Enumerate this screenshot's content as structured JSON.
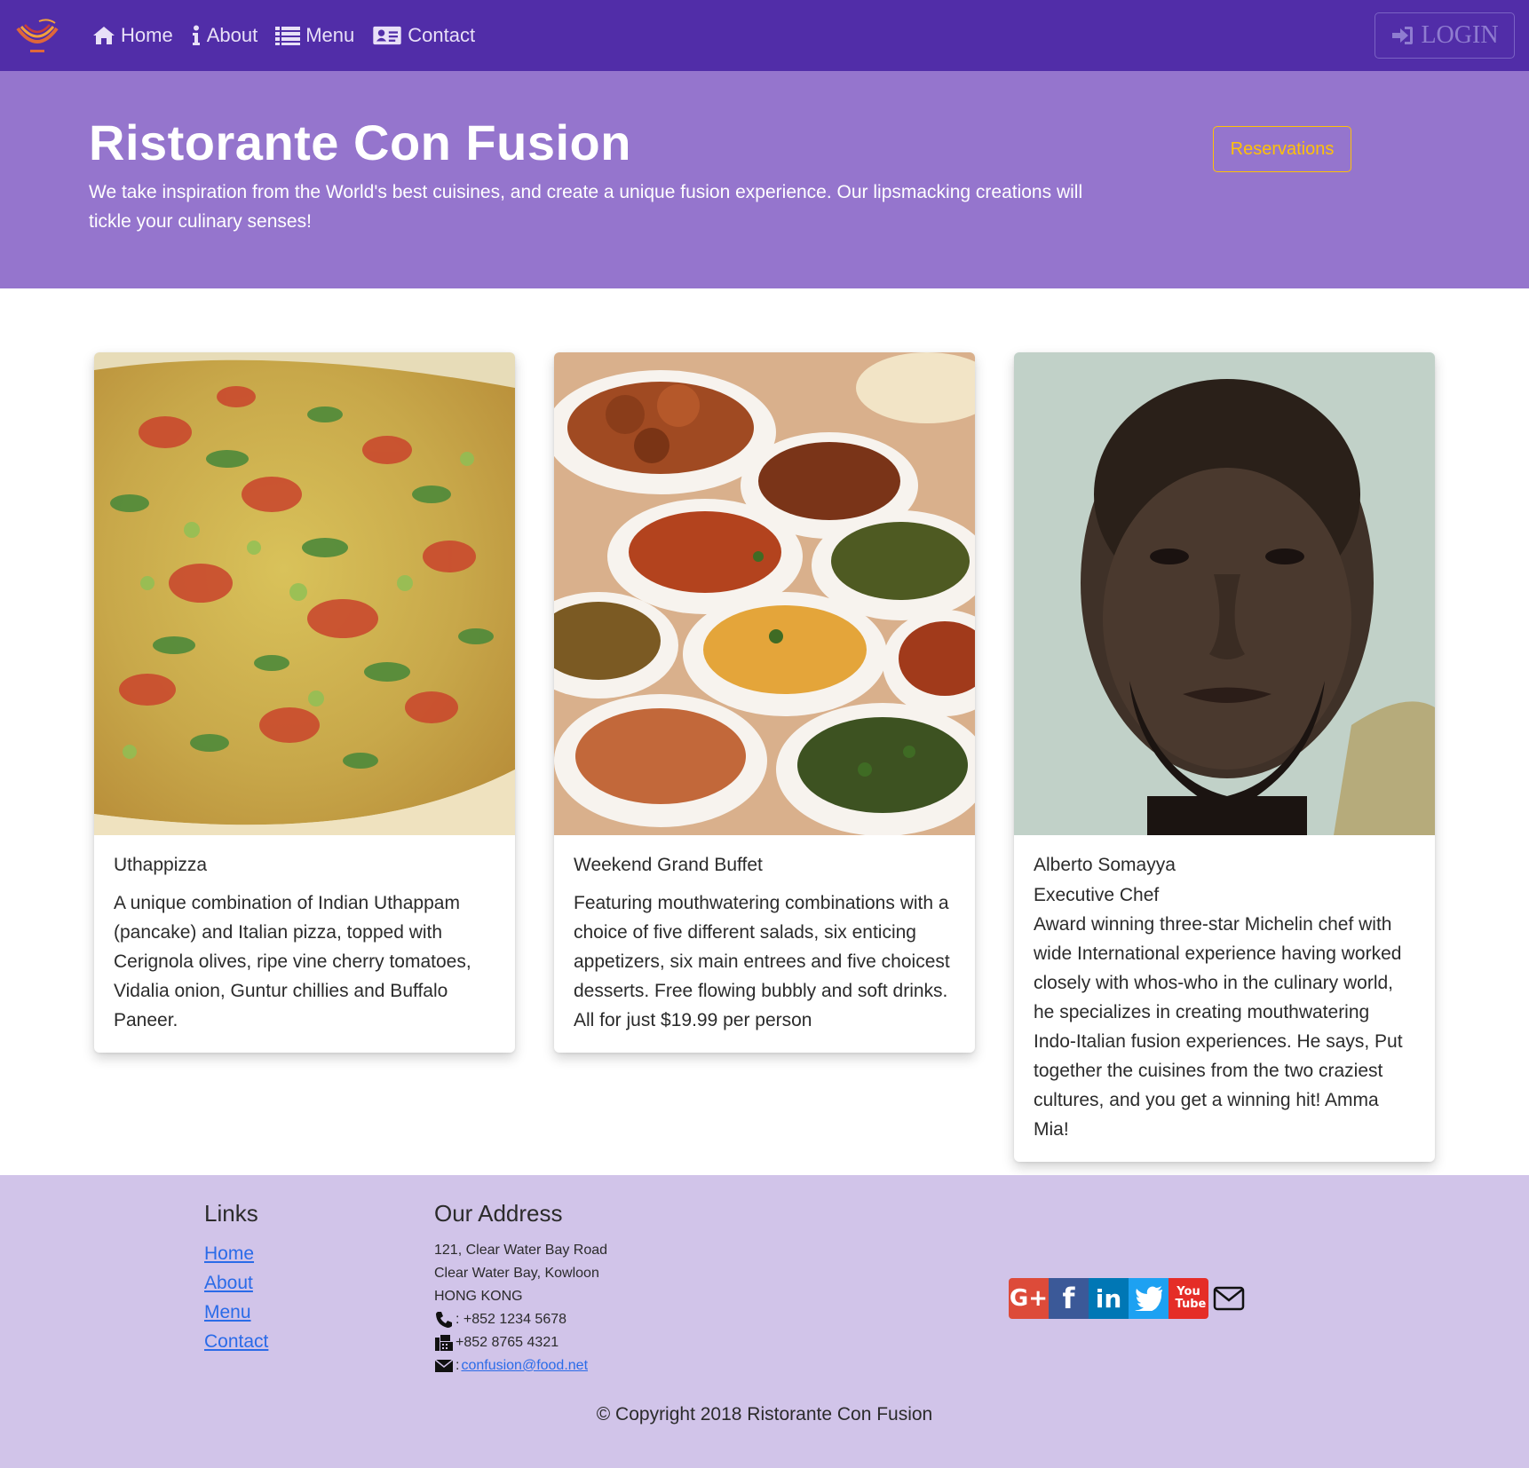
{
  "nav": {
    "items": [
      {
        "label": "Home",
        "icon": "home-icon"
      },
      {
        "label": "About",
        "icon": "info-icon"
      },
      {
        "label": "Menu",
        "icon": "list-icon"
      },
      {
        "label": "Contact",
        "icon": "address-card-icon"
      }
    ],
    "login_label": "LOGIN"
  },
  "jumbotron": {
    "title": "Ristorante Con Fusion",
    "text": "We take inspiration from the World's best cuisines, and create a unique fusion experience. Our lipsmacking creations will tickle your culinary senses!",
    "reserve_label": "Reservations"
  },
  "cards": [
    {
      "title": "Uthappizza",
      "subtitle": "",
      "text": "A unique combination of Indian Uthappam (pancake) and Italian pizza, topped with Cerignola olives, ripe vine cherry tomatoes, Vidalia onion, Guntur chillies and Buffalo Paneer."
    },
    {
      "title": "Weekend Grand Buffet",
      "subtitle": "",
      "text": "Featuring mouthwatering combinations with a choice of five different salads, six enticing appetizers, six main entrees and five choicest desserts. Free flowing bubbly and soft drinks. All for just $19.99 per person"
    },
    {
      "title": "Alberto Somayya",
      "subtitle": "Executive Chef",
      "text": "Award winning three-star Michelin chef with wide International experience having worked closely with whos-who in the culinary world, he specializes in creating mouthwatering Indo-Italian fusion experiences. He says, Put together the cuisines from the two craziest cultures, and you get a winning hit! Amma Mia!"
    }
  ],
  "footer": {
    "links_heading": "Links",
    "links": [
      "Home",
      "About",
      "Menu",
      "Contact"
    ],
    "address_heading": "Our Address",
    "address_lines": [
      "121, Clear Water Bay Road",
      "Clear Water Bay, Kowloon",
      "HONG KONG"
    ],
    "phone": ": +852 1234 5678",
    "fax": " +852 8765 4321",
    "email_prefix": ":",
    "email": "confusion@food.net",
    "social": [
      {
        "label": "G+",
        "color": "#dd4b39"
      },
      {
        "label": "f",
        "color": "#3b5998"
      },
      {
        "label": "in",
        "color": "#0077b5"
      },
      {
        "label": "t",
        "color": "#1da1f2"
      },
      {
        "label": "You Tube",
        "color": "#e52d27"
      }
    ],
    "copyright": "© Copyright 2018 Ristorante Con Fusion"
  },
  "colors": {
    "navbar": "#512DA8",
    "jumbotron": "#9575CD",
    "footer": "#D1C4E9",
    "accent": "#FFC107"
  }
}
